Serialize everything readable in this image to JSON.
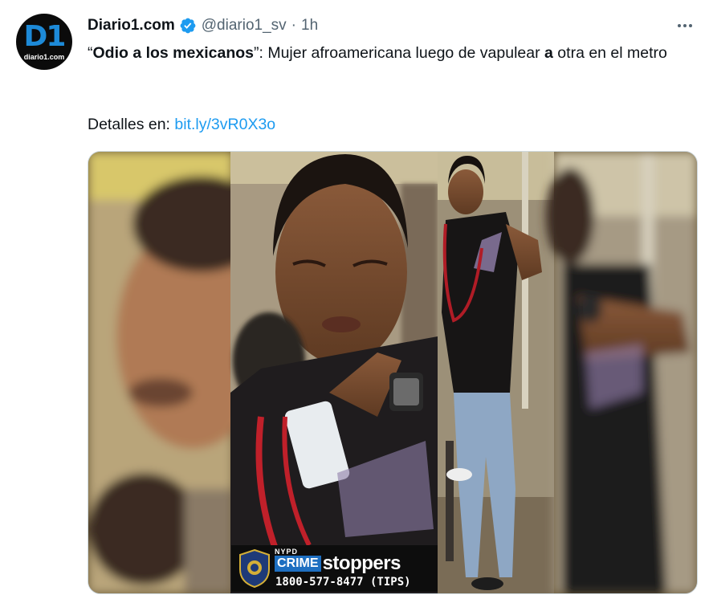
{
  "account": {
    "display_name": "Diario1.com",
    "handle": "@diario1_sv",
    "separator": "·",
    "time": "1h",
    "avatar_logo": "D1",
    "avatar_subtext": "diario1.com",
    "verified_icon": "verified-badge-icon"
  },
  "tweet": {
    "quote_open": "“",
    "headline_bold": "Odio a los mexicanos",
    "quote_close": "”",
    "text_part1": ": Mujer afroamericana luego de vapulear ",
    "text_bold_a": "a",
    "text_part2": " otra en el metro",
    "details_label": "Detalles en: ",
    "link_text": "bit.ly/3vR0X3o"
  },
  "media": {
    "alt_panels": [
      "blurred-close-up",
      "close-up-face",
      "full-body-standing",
      "blurred-torso"
    ],
    "badge": {
      "nypd": "NYPD",
      "crime": "CRIME",
      "stoppers": "stoppers",
      "phone": "1800-577-8477 (TIPS)"
    }
  },
  "colors": {
    "link": "#1d9bf0",
    "verified": "#1d9bf0",
    "secondary_text": "#536471",
    "crimestoppers_blue": "#1e6fc1"
  },
  "icons": {
    "more": "more-horizontal-icon"
  }
}
